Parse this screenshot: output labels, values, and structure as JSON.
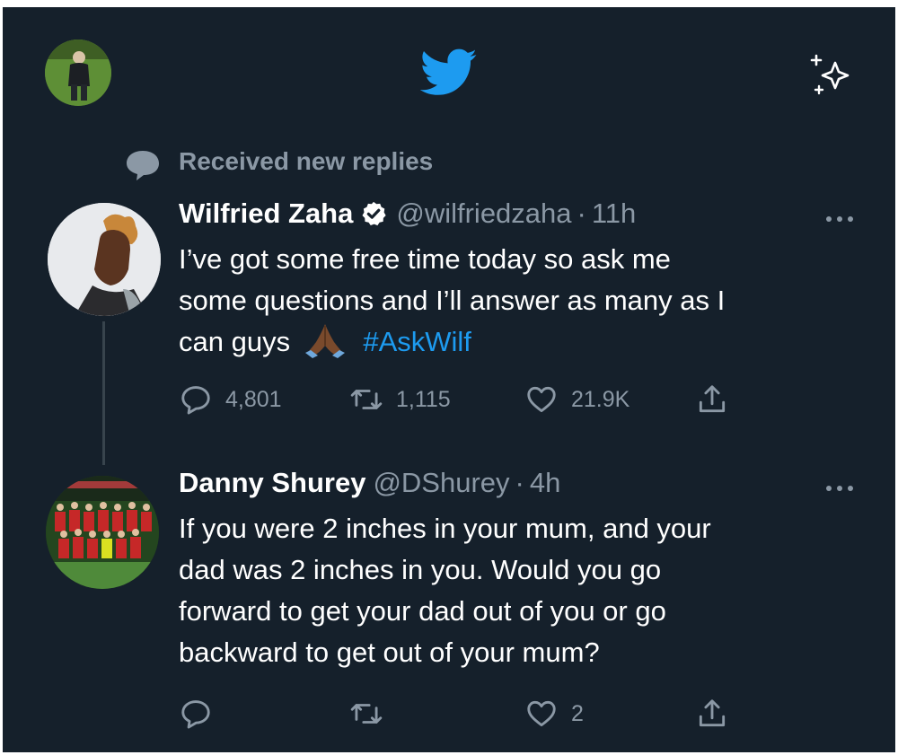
{
  "context": {
    "label": "Received new replies"
  },
  "tweets": [
    {
      "author": "Wilfried Zaha",
      "verified": true,
      "handle": "@wilfriedzaha",
      "separator": "·",
      "time": "11h",
      "lines": [
        "I’ve got some free time today so ask me",
        "some questions and I’ll answer as many as I",
        "can guys"
      ],
      "hashtag": "#AskWilf",
      "replies": "4,801",
      "retweets": "1,115",
      "likes": "21.9K"
    },
    {
      "author": "Danny Shurey",
      "verified": false,
      "handle": "@DShurey",
      "separator": "·",
      "time": "4h",
      "lines": [
        "If you were 2 inches in your mum, and your",
        "dad was 2 inches in you. Would you go",
        "forward to get your dad out of you or go",
        "backward to get out of your mum?"
      ],
      "likes": "2"
    }
  ],
  "icons": {
    "top": [
      "profile-avatar",
      "twitter-logo-icon",
      "sparkle-icon"
    ],
    "actions": [
      "reply-icon",
      "retweet-icon",
      "like-icon",
      "share-icon"
    ],
    "context": "speech-bubble-icon",
    "verified": "verified-badge-icon",
    "more": "more-options-icon",
    "emoji": "folded-hands-emoji"
  },
  "colors": {
    "background": "#15202b",
    "text": "#ffffff",
    "secondary": "#8b98a5",
    "accent": "#1d9bf0",
    "thread_line": "#38444d"
  }
}
